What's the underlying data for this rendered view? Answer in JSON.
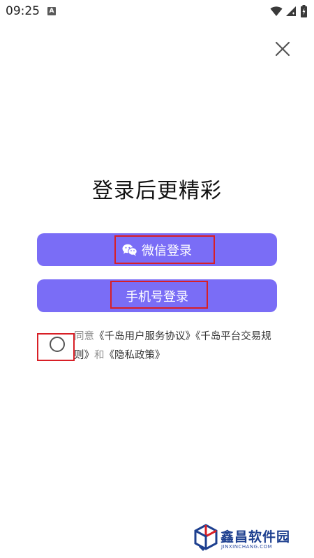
{
  "status_bar": {
    "time": "09:25",
    "notification_badge": "A"
  },
  "title": "登录后更精彩",
  "buttons": {
    "wechat_label": "微信登录",
    "phone_label": "手机号登录"
  },
  "agreement": {
    "prefix": "同意",
    "service_agreement": "《千岛用户服务协议》",
    "trading_rules": "《千岛平台交易规则》",
    "and": "和",
    "privacy_policy": "《隐私政策》"
  },
  "watermark": {
    "name": "鑫昌软件园",
    "domain": "JINXINCHANG.COM"
  },
  "colors": {
    "button_bg": "#7a6df6",
    "highlight": "#d81f26",
    "watermark": "#1d3f8f"
  }
}
